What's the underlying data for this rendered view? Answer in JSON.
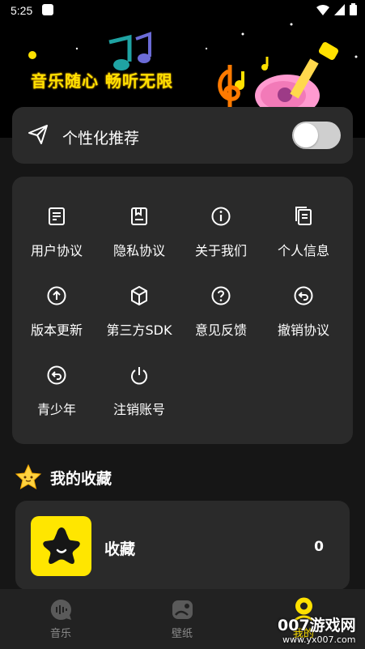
{
  "status_bar": {
    "time": "5:25"
  },
  "banner": {
    "slogan": "音乐随心 畅听无限"
  },
  "recommend": {
    "label": "个性化推荐",
    "enabled": false
  },
  "menu": {
    "items": [
      {
        "label": "用户协议",
        "icon": "document-icon"
      },
      {
        "label": "隐私协议",
        "icon": "privacy-book-icon"
      },
      {
        "label": "关于我们",
        "icon": "info-icon"
      },
      {
        "label": "个人信息",
        "icon": "copy-icon"
      },
      {
        "label": "版本更新",
        "icon": "upload-arrow-icon"
      },
      {
        "label": "第三方SDK",
        "icon": "cube-icon"
      },
      {
        "label": "意见反馈",
        "icon": "question-icon"
      },
      {
        "label": "撤销协议",
        "icon": "undo-icon"
      },
      {
        "label": "青少年",
        "icon": "undo-icon"
      },
      {
        "label": "注销账号",
        "icon": "power-icon"
      }
    ]
  },
  "favorites": {
    "title": "我的收藏",
    "item_name": "收藏",
    "count": "0"
  },
  "tabbar": {
    "tabs": [
      {
        "label": "音乐",
        "active": false
      },
      {
        "label": "壁纸",
        "active": false
      },
      {
        "label": "我的",
        "active": true
      }
    ]
  },
  "watermark": {
    "brand": "007游戏网",
    "url": "www.yx007.com"
  },
  "colors": {
    "accent": "#ffe100",
    "card": "#2a2a2a",
    "background": "#161616"
  }
}
